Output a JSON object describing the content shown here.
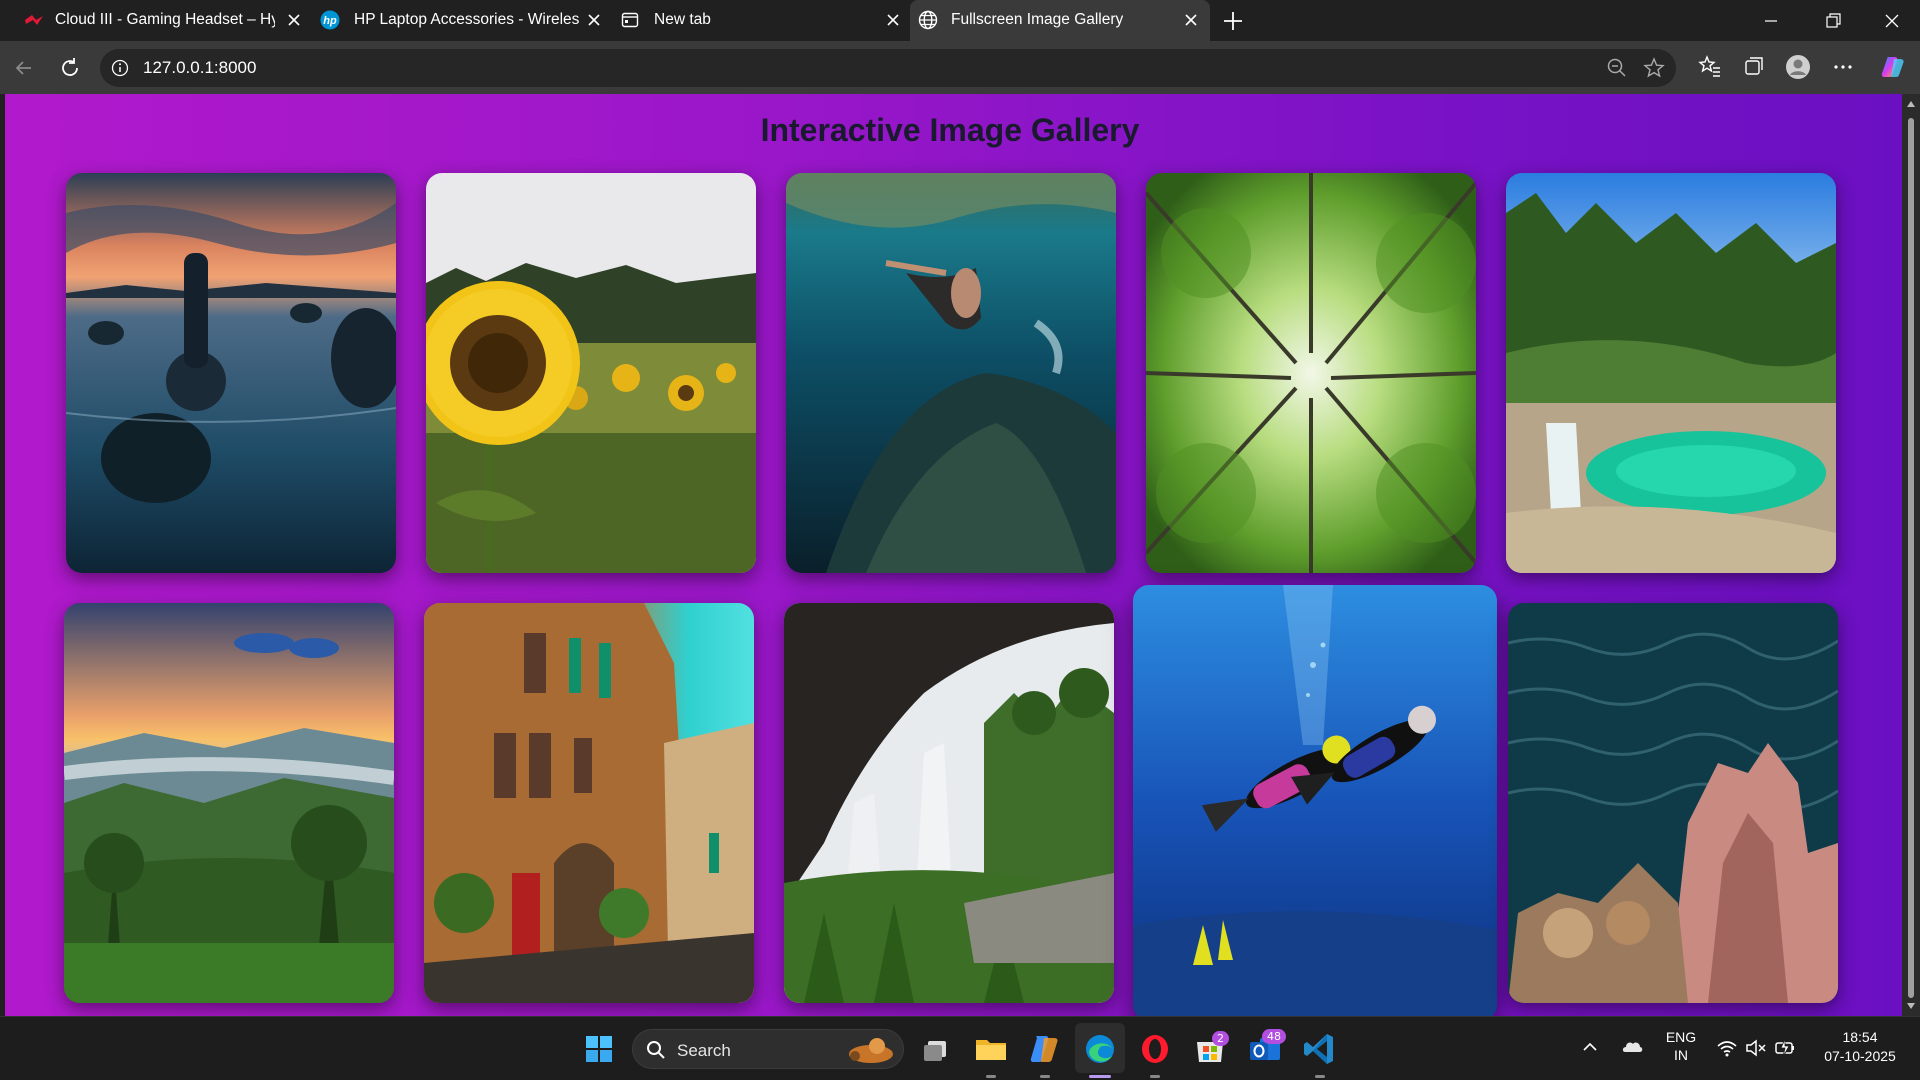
{
  "browser": {
    "tabs": [
      {
        "title": "Cloud III - Gaming Headset – Hyp",
        "icon": "hyperx-icon"
      },
      {
        "title": "HP Laptop Accessories - Wireless",
        "icon": "hp-icon"
      },
      {
        "title": "New tab",
        "icon": "newtab-icon"
      },
      {
        "title": "Fullscreen Image Gallery",
        "icon": "globe-icon",
        "active": true
      }
    ],
    "url": "127.0.0.1:8000"
  },
  "page": {
    "title": "Interactive Image Gallery",
    "background": [
      "#b119cc",
      "#6a10c2"
    ],
    "images": [
      {
        "subject": "rocks at sunset lake"
      },
      {
        "subject": "sunflower field"
      },
      {
        "subject": "underwater snorkeler"
      },
      {
        "subject": "forest canopy from below"
      },
      {
        "subject": "turquoise waterfall pool"
      },
      {
        "subject": "misty hills at sunrise"
      },
      {
        "subject": "stone building with green shutters"
      },
      {
        "subject": "waterfall cave"
      },
      {
        "subject": "scuba divers",
        "hovered": true
      },
      {
        "subject": "coral rocks in sea"
      }
    ]
  },
  "taskbar": {
    "search_label": "Search",
    "store_badge": "2",
    "outlook_badge": "48",
    "lang_top": "ENG",
    "lang_bottom": "IN",
    "time": "18:54",
    "date": "07-10-2025"
  }
}
